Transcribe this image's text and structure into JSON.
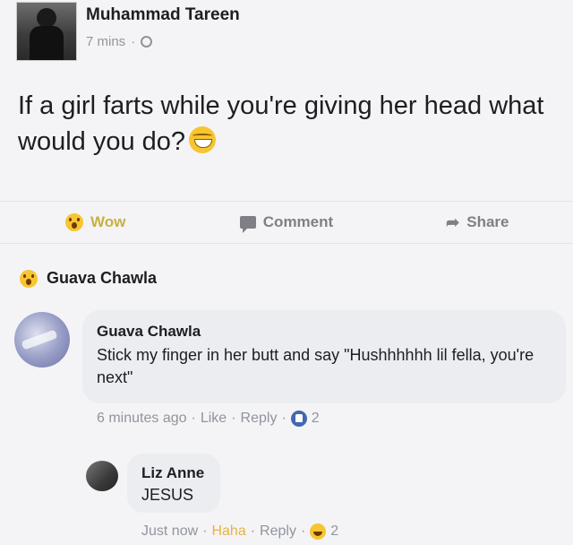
{
  "post": {
    "author": "Muhammad Tareen",
    "time": "7 mins",
    "separator": "·",
    "privacy_icon": "globe-icon",
    "text": "If a girl farts while you're giving her head what would you do?",
    "text_emoji": "laughing-crying-emoji"
  },
  "actions": {
    "reaction_label": "Wow",
    "comment_label": "Comment",
    "share_label": "Share"
  },
  "reaction_summary": {
    "icon": "wow-emoji",
    "name": "Guava Chawla"
  },
  "comments": [
    {
      "author": "Guava Chawla",
      "text": "Stick my finger in her butt and say \"Hushhhhhh lil fella, you're next\"",
      "time": "6 minutes ago",
      "sep1": "·",
      "like": "Like",
      "sep2": "·",
      "reply": "Reply",
      "sep3": "·",
      "reaction_icon": "like-icon",
      "reaction_count": "2"
    },
    {
      "author": "Liz Anne",
      "text": "JESUS",
      "time": "Just now",
      "sep1": "·",
      "like": "Haha",
      "sep2": "·",
      "reply": "Reply",
      "sep3": "·",
      "reaction_icon": "haha-icon",
      "reaction_count": "2"
    }
  ],
  "colors": {
    "background": "#f4f4f6",
    "bubble": "#ebedf0",
    "meta_text": "#90949c",
    "wow_label": "#c8b040",
    "haha_label": "#e8b342",
    "like_blue": "#4267b2"
  }
}
